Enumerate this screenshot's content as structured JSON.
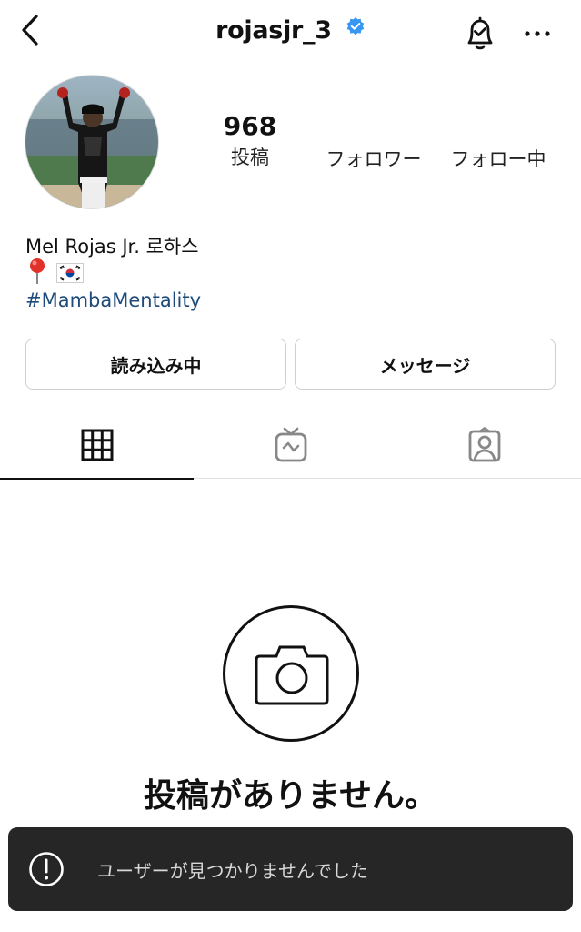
{
  "header": {
    "username": "rojasjr_3",
    "verified": true,
    "icons": [
      "back-chevron-icon",
      "verified-badge-icon",
      "notification-bell-icon",
      "more-options-icon"
    ]
  },
  "profile": {
    "posts_count": "968",
    "posts_label": "投稿",
    "followers_label": "フォロワー",
    "following_label": "フォロー中",
    "name": "Mel Rojas Jr. 로하스",
    "bio_emojis": [
      "round-pushpin",
      "south-korea-flag"
    ],
    "hashtag": "#MambaMentality"
  },
  "actions": {
    "loading_label": "読み込み中",
    "message_label": "メッセージ"
  },
  "tabs": [
    {
      "name": "grid",
      "icon": "grid-icon",
      "active": true
    },
    {
      "name": "igtv",
      "icon": "igtv-icon",
      "active": false
    },
    {
      "name": "tagged",
      "icon": "tagged-user-icon",
      "active": false
    }
  ],
  "empty_state": {
    "icon": "camera-icon",
    "message": "投稿がありません。"
  },
  "toast": {
    "icon": "alert-icon",
    "message": "ユーザーが見つかりませんでした"
  },
  "colors": {
    "hashtag": "#1f4b7a",
    "verified": "#3897f0",
    "toast_bg": "#262626"
  }
}
